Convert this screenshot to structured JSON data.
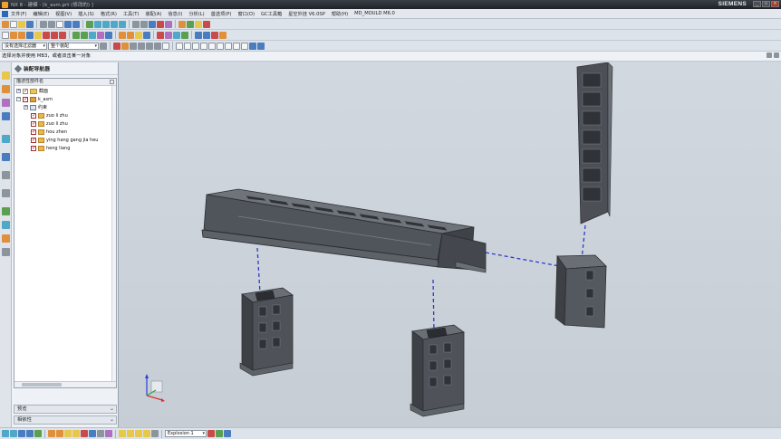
{
  "window": {
    "title": "NX 8 - 建模 - [k_asm.prt (修改的) ]",
    "brand": "SIEMENS"
  },
  "menu": [
    "文件(F)",
    "编辑(E)",
    "视图(V)",
    "插入(S)",
    "格式(R)",
    "工具(T)",
    "装配(A)",
    "信息(I)",
    "分析(L)",
    "首选项(P)",
    "窗口(O)",
    "GC工具箱",
    "星空外挂 V6.0SP",
    "帮助(H)",
    "MD_MOULD M6.0"
  ],
  "toolbars": {
    "filter_value": "没有选择过滤器",
    "scope_value": "整个装配",
    "explosion_value": "Explosion 1"
  },
  "cue": "选择对象并使用 MB3，或者双击某一对象",
  "navigator": {
    "title": "装配导航器",
    "column_header": "描述性部件名",
    "items": [
      {
        "label": "截面",
        "depth": 0,
        "icon": "folder",
        "checked": false,
        "expander": "+"
      },
      {
        "label": "k_asm",
        "depth": 0,
        "icon": "assembly",
        "checked": true,
        "expander": "-"
      },
      {
        "label": "约束",
        "depth": 1,
        "icon": "constraint",
        "checked": false,
        "expander": "+"
      },
      {
        "label": "zuo li zhu",
        "depth": 2,
        "icon": "component",
        "checked": true,
        "expander": ""
      },
      {
        "label": "zuo li zhu",
        "depth": 2,
        "icon": "component",
        "checked": true,
        "expander": ""
      },
      {
        "label": "hou zhen",
        "depth": 2,
        "icon": "component",
        "checked": true,
        "expander": ""
      },
      {
        "label": "ying hang gang jia heu",
        "depth": 2,
        "icon": "component",
        "checked": true,
        "expander": ""
      },
      {
        "label": "heng liang",
        "depth": 2,
        "icon": "component",
        "checked": true,
        "expander": ""
      }
    ],
    "panels": [
      "预览",
      "相依性"
    ]
  },
  "colors": {
    "viewport_bg": "#cbd1d9",
    "part_dark": "#4c5056",
    "part_light": "#6f747b",
    "explosion_line": "#2c3cc8"
  }
}
